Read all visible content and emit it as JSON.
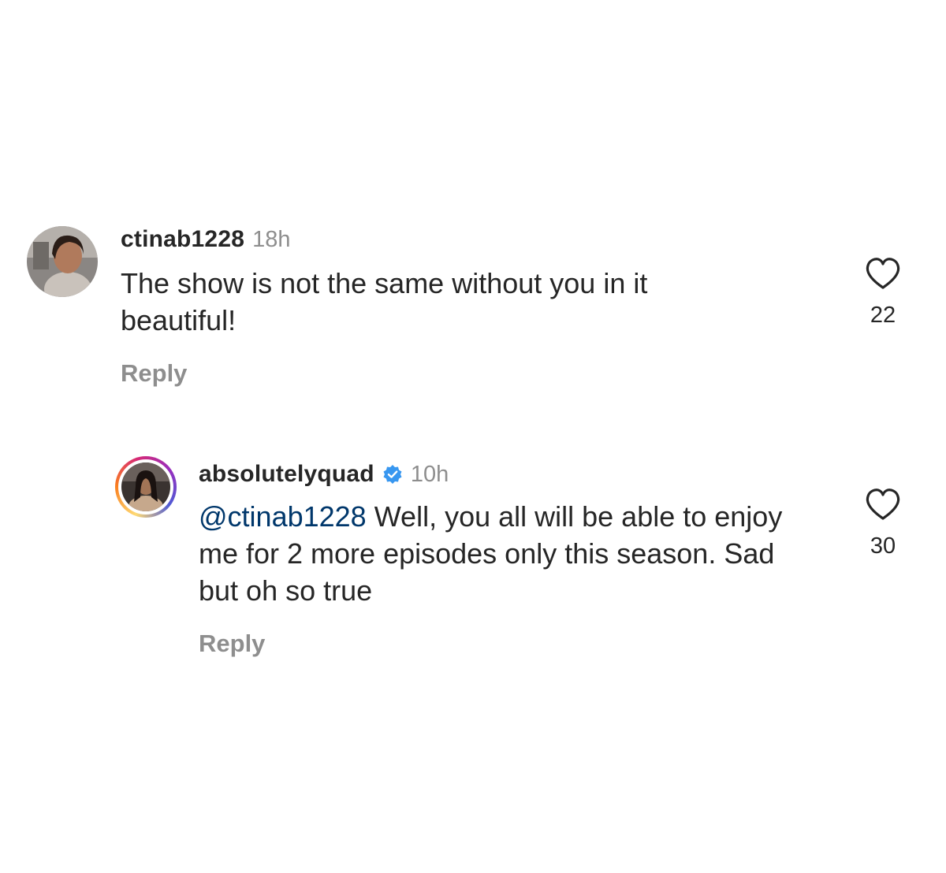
{
  "comments": [
    {
      "username": "ctinab1228",
      "time": "18h",
      "text": "The show is not the same without you in it beautiful!",
      "reply_label": "Reply",
      "likes": "22",
      "avatar_icon": "profile-photo",
      "heart_icon": "heart-outline-icon"
    },
    {
      "username": "absolutelyquad",
      "verified": true,
      "verified_icon": "verified-badge-icon",
      "time": "10h",
      "mention": "@ctinab1228",
      "text": "Well, you all will be able to enjoy me for 2 more episodes only this season. Sad but oh so true",
      "reply_label": "Reply",
      "likes": "30",
      "avatar_icon": "profile-photo-story-ring",
      "heart_icon": "heart-outline-icon"
    }
  ],
  "colors": {
    "text": "#262626",
    "secondary": "#8e8e8e",
    "mention": "#00376b",
    "verified": "#3897f0"
  }
}
